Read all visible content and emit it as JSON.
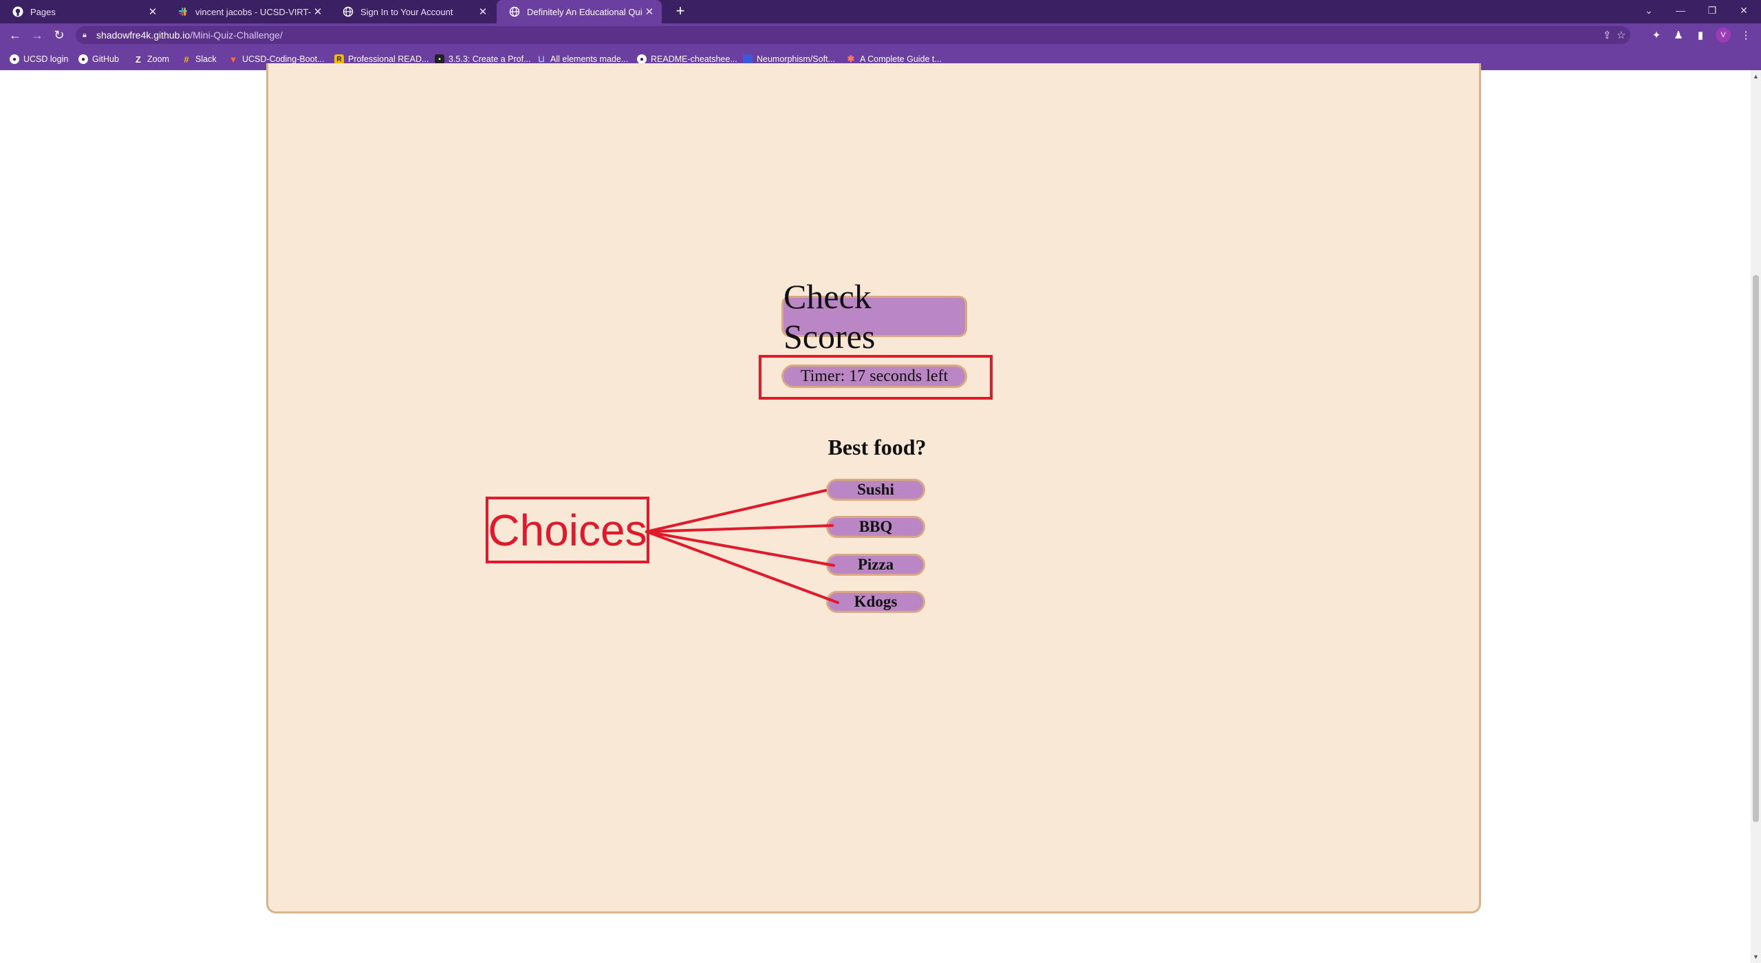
{
  "browser": {
    "tabs": [
      {
        "title": "Pages",
        "icon": "github-icon"
      },
      {
        "title": "vincent jacobs - UCSD-VIRT-FSF",
        "icon": "slack-icon"
      },
      {
        "title": "Sign In to Your Account",
        "icon": "globe-icon"
      },
      {
        "title": "Definitely An Educational Quiz",
        "icon": "globe-icon"
      }
    ],
    "address": {
      "host": "shadowfre4k.github.io",
      "path": "/Mini-Quiz-Challenge/"
    },
    "avatar_letter": "V",
    "bookmarks": [
      {
        "label": "UCSD login"
      },
      {
        "label": "GitHub"
      },
      {
        "label": "Zoom"
      },
      {
        "label": "Slack"
      },
      {
        "label": "UCSD-Coding-Boot..."
      },
      {
        "label": "Professional READ..."
      },
      {
        "label": "3.5.3: Create a Prof..."
      },
      {
        "label": "All elements made..."
      },
      {
        "label": "README-cheatshee..."
      },
      {
        "label": "Neumorphism/Soft..."
      },
      {
        "label": "A Complete Guide t..."
      }
    ]
  },
  "quiz": {
    "check_scores_label": "Check Scores",
    "timer_text": "Timer: 17 seconds left",
    "question": "Best food?",
    "choices": [
      "Sushi",
      "BBQ",
      "Pizza",
      "Kdogs"
    ]
  },
  "annotation": {
    "label": "Choices",
    "color": "#e0192b"
  },
  "colors": {
    "tab_bar": "#3b2163",
    "toolbar": "#6b3fa0",
    "card_background": "#f8e8d5",
    "pill": "#bb86c4",
    "pill_border": "#d9aa82"
  }
}
